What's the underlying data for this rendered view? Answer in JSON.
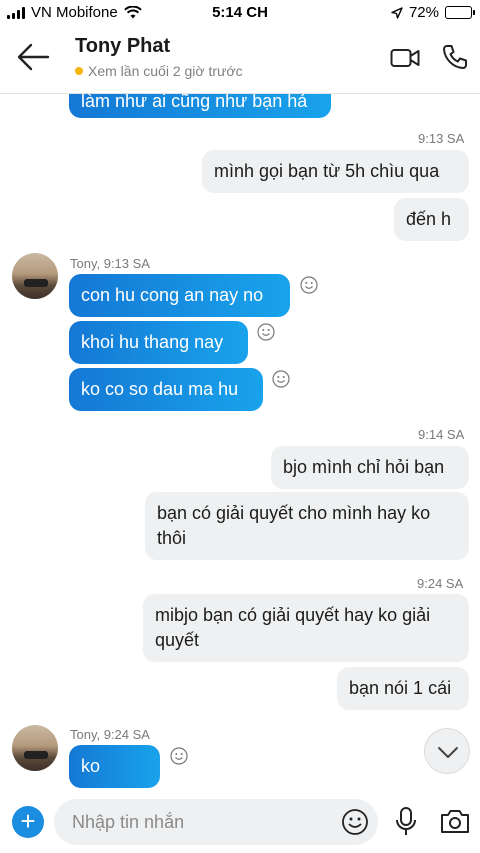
{
  "status_bar": {
    "carrier": "VN Mobifone",
    "time": "5:14 CH",
    "battery": "72%",
    "battery_level": 0.72
  },
  "header": {
    "contact_name": "Tony Phat",
    "last_seen": "Xem lần cuối 2 giờ trước",
    "status_color": "#f5b50a"
  },
  "colors": {
    "incoming_bubble": "#1a8de0",
    "outgoing_bubble": "#eef0f2",
    "accent": "#1a8de0"
  },
  "messages": {
    "cut_off": "làm như ai cũng như bạn hả",
    "time_1": "9:13 SA",
    "out_1": "mình gọi bạn từ 5h chìu qua",
    "out_2": "đến h",
    "sender_1": "Tony, 9:13 SA",
    "in_1": "con hu cong an nay no",
    "in_2": "khoi hu thang nay",
    "in_3": "ko co so dau ma hu",
    "time_2": "9:14 SA",
    "out_3": "bjo mình chỉ hỏi bạn",
    "out_4": "bạn có giải quyết cho mình hay ko thôi",
    "time_3": "9:24 SA",
    "out_5": "mibjo bạn có giải quyết hay ko giải quyết",
    "out_6": "bạn nói 1 cái",
    "sender_2": "Tony, 9:24 SA",
    "in_4": "ko"
  },
  "composer": {
    "placeholder": "Nhập tin nhắn"
  },
  "icons": {
    "back": "arrow-left-icon",
    "video": "video-camera-icon",
    "call": "phone-icon",
    "reaction": "smiley-icon",
    "scroll": "chevron-down-icon",
    "add": "plus-icon",
    "emoji": "emoji-icon",
    "mic": "microphone-icon",
    "camera": "camera-icon"
  }
}
